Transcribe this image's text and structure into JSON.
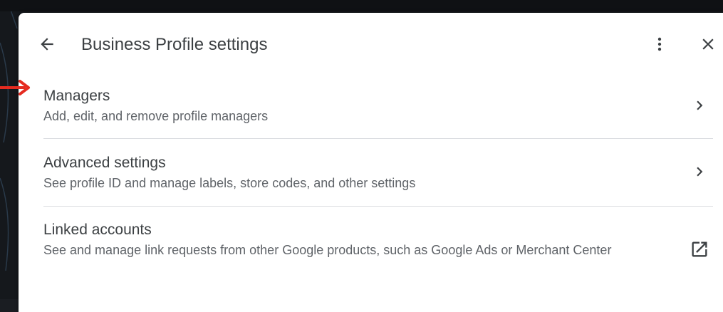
{
  "header": {
    "title": "Business Profile settings",
    "back_icon": "arrow-back-icon",
    "more_icon": "more-vert-icon",
    "close_icon": "close-icon"
  },
  "items": [
    {
      "title": "Managers",
      "subtitle": "Add, edit, and remove profile managers",
      "action_icon": "chevron-right-icon"
    },
    {
      "title": "Advanced settings",
      "subtitle": "See profile ID and manage labels, store codes, and other settings",
      "action_icon": "chevron-right-icon"
    },
    {
      "title": "Linked accounts",
      "subtitle": "See and manage link requests from other Google products, such as Google Ads or Merchant Center",
      "action_icon": "open-in-new-icon"
    }
  ],
  "annotation": {
    "arrow_color": "#e52b20"
  },
  "colors": {
    "text_primary": "#3c4043",
    "text_secondary": "#5f6368",
    "divider": "#dadce0",
    "panel_bg": "#ffffff"
  }
}
